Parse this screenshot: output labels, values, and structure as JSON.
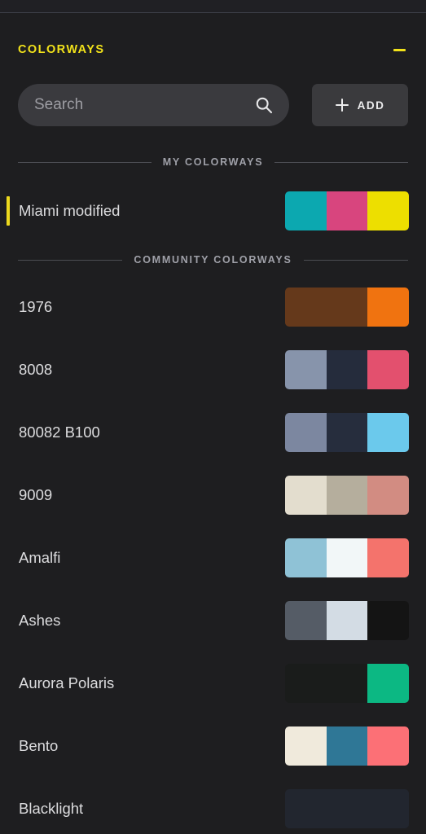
{
  "panel": {
    "background": "#1e1e20",
    "accent": "#f2e21a"
  },
  "header": {
    "title": "COLORWAYS",
    "collapse_icon": "minus-icon"
  },
  "search": {
    "placeholder": "Search",
    "value": "",
    "icon": "search-icon"
  },
  "add_button": {
    "label": "ADD",
    "icon": "plus-icon"
  },
  "sections": [
    {
      "id": "my",
      "label": "MY COLORWAYS"
    },
    {
      "id": "community",
      "label": "COMMUNITY COLORWAYS"
    }
  ],
  "my_colorways": [
    {
      "name": "Miami modified",
      "selected": true,
      "accent": "#edd91e",
      "swatches": [
        "#0ca8b0",
        "#d8457e",
        "#eddf00"
      ]
    }
  ],
  "community_colorways": [
    {
      "name": "1976",
      "selected": false,
      "swatches": [
        "#65391b",
        "#65391b",
        "#f07310"
      ]
    },
    {
      "name": "8008",
      "selected": false,
      "swatches": [
        "#8794ab",
        "#252c3c",
        "#e3506e"
      ]
    },
    {
      "name": "80082 B100",
      "selected": false,
      "swatches": [
        "#7c87a0",
        "#262d3d",
        "#6bc9ec"
      ]
    },
    {
      "name": "9009",
      "selected": false,
      "swatches": [
        "#e3ddce",
        "#b5ae9d",
        "#d28c82"
      ]
    },
    {
      "name": "Amalfi",
      "selected": false,
      "swatches": [
        "#8fc2d6",
        "#f2f7f8",
        "#f4736c"
      ]
    },
    {
      "name": "Ashes",
      "selected": false,
      "swatches": [
        "#555c66",
        "#d3dce4",
        "#141414"
      ]
    },
    {
      "name": "Aurora Polaris",
      "selected": false,
      "swatches": [
        "#1a1c1b",
        "#1a1c1b",
        "#0cb883"
      ]
    },
    {
      "name": "Bento",
      "selected": false,
      "swatches": [
        "#f0eadc",
        "#2f7796",
        "#fc7076"
      ]
    },
    {
      "name": "Blacklight",
      "selected": false,
      "swatches": [
        "#22262f",
        "#22262f",
        "#22262f"
      ]
    }
  ]
}
